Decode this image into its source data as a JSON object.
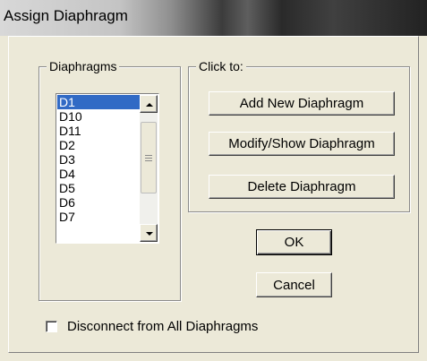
{
  "window": {
    "title": "Assign Diaphragm"
  },
  "diaphragms_group": {
    "label": "Diaphragms",
    "items": [
      "D1",
      "D10",
      "D11",
      "D2",
      "D3",
      "D4",
      "D5",
      "D6",
      "D7"
    ],
    "selected": "D1"
  },
  "click_to_group": {
    "label": "Click to:",
    "add_label": "Add New Diaphragm",
    "modify_label": "Modify/Show Diaphragm",
    "delete_label": "Delete Diaphragm"
  },
  "actions": {
    "ok_label": "OK",
    "cancel_label": "Cancel"
  },
  "disconnect": {
    "label": "Disconnect from All Diaphragms",
    "checked": false
  },
  "colors": {
    "selection": "#316ac5",
    "face": "#ece9d8"
  },
  "icons": [
    "scroll-up-arrow-icon",
    "scroll-down-arrow-icon",
    "scroll-grip-icon"
  ]
}
